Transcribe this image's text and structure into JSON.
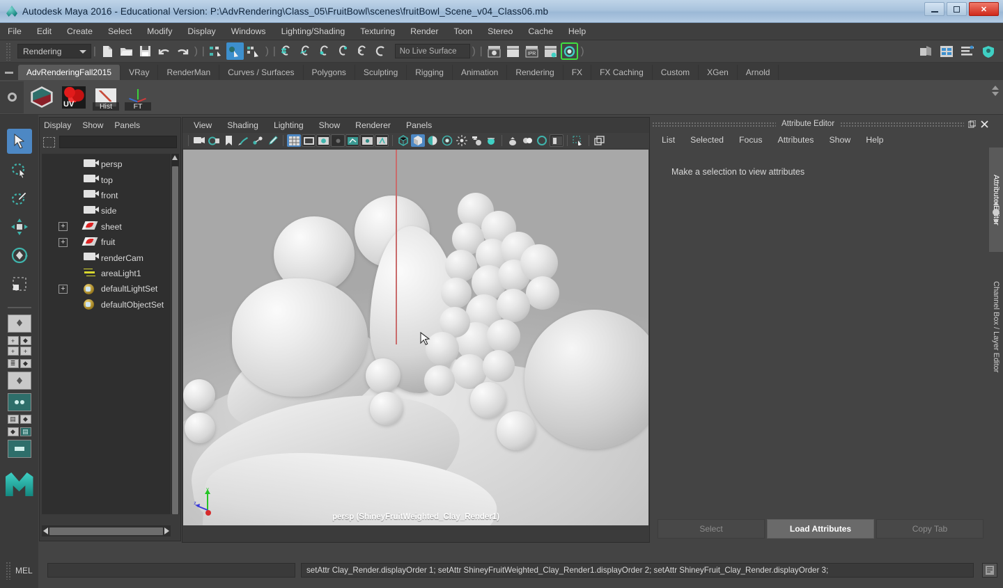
{
  "window": {
    "title": "Autodesk Maya 2016 - Educational Version: P:\\AdvRendering\\Class_05\\FruitBowl\\scenes\\fruitBowl_Scene_v04_Class06.mb",
    "app_icon": "maya-logo-icon",
    "minimize": "–",
    "maximize": "□",
    "close": "✕"
  },
  "menubar": {
    "items": [
      "File",
      "Edit",
      "Create",
      "Select",
      "Modify",
      "Display",
      "Windows",
      "Lighting/Shading",
      "Texturing",
      "Render",
      "Toon",
      "Stereo",
      "Cache",
      "Help"
    ]
  },
  "statusline": {
    "menuset": "Rendering",
    "live_surface": "No Live Surface",
    "file_icons": [
      "new-scene-icon",
      "open-scene-icon",
      "save-scene-icon",
      "undo-icon",
      "redo-icon"
    ],
    "select_mode_icons": [
      "select-hierarchy-icon",
      "select-object-icon",
      "select-component-icon"
    ],
    "snap_icons": [
      "snap-grid-icon",
      "snap-curve-icon",
      "snap-point-icon",
      "snap-projected-center-icon",
      "snap-view-plane-icon",
      "make-live-icon"
    ],
    "render_icons": [
      "render-current-frame-icon",
      "render-sequence-icon",
      "ipr-render-icon",
      "render-settings-icon",
      "render-view-icon"
    ],
    "right_icons": [
      "hypergraph-icon",
      "attribute-editor-toggle-icon",
      "channel-box-toggle-icon",
      "tool-settings-icon"
    ]
  },
  "shelf": {
    "tabs": [
      "AdvRenderingFall2015",
      "VRay",
      "RenderMan",
      "Curves / Surfaces",
      "Polygons",
      "Sculpting",
      "Rigging",
      "Animation",
      "Rendering",
      "FX",
      "FX Caching",
      "Custom",
      "XGen",
      "Arnold"
    ],
    "active_tab": "AdvRenderingFall2015",
    "buttons": [
      {
        "name": "cube-shader-icon",
        "label": ""
      },
      {
        "name": "uv-texture-icon",
        "label": "UV"
      },
      {
        "name": "history-icon",
        "label": "Hist"
      },
      {
        "name": "freeze-transform-icon",
        "label": "FT"
      }
    ]
  },
  "toolbox": {
    "tools": [
      {
        "name": "select-tool",
        "icon": "arrow-cursor-icon",
        "selected": true
      },
      {
        "name": "lasso-select-tool",
        "icon": "lasso-icon",
        "selected": false
      },
      {
        "name": "paint-select-tool",
        "icon": "paint-brush-icon",
        "selected": false
      },
      {
        "name": "move-tool",
        "icon": "move-arrows-icon",
        "selected": false
      },
      {
        "name": "rotate-tool",
        "icon": "rotate-circle-icon",
        "selected": false
      },
      {
        "name": "scale-tool",
        "icon": "scale-box-icon",
        "selected": false
      }
    ],
    "layout_label": "quick-layout-buttons"
  },
  "outliner": {
    "menus": [
      "Display",
      "Show",
      "Panels"
    ],
    "search_placeholder": "",
    "search_value": "",
    "items": [
      {
        "label": "persp",
        "icon": "camera-icon",
        "expandable": false
      },
      {
        "label": "top",
        "icon": "camera-icon",
        "expandable": false
      },
      {
        "label": "front",
        "icon": "camera-icon",
        "expandable": false
      },
      {
        "label": "side",
        "icon": "camera-icon",
        "expandable": false
      },
      {
        "label": "sheet",
        "icon": "mesh-icon",
        "expandable": true
      },
      {
        "label": "fruit",
        "icon": "mesh-icon",
        "expandable": true
      },
      {
        "label": "renderCam",
        "icon": "camera-icon",
        "expandable": false
      },
      {
        "label": "areaLight1",
        "icon": "light-icon",
        "expandable": false
      },
      {
        "label": "defaultLightSet",
        "icon": "set-icon",
        "expandable": true
      },
      {
        "label": "defaultObjectSet",
        "icon": "set-icon",
        "expandable": false
      }
    ]
  },
  "viewport": {
    "menus": [
      "View",
      "Shading",
      "Lighting",
      "Show",
      "Renderer",
      "Panels"
    ],
    "caption": "persp (ShineyFruitWeighted_Clay_Render1)",
    "toolbar_icons": [
      "camera-attributes-icon",
      "two-sided-lighting-icon",
      "bookmark-icon",
      "grease-pencil-icon",
      "ik-handle-icon",
      "paint-effects-icon",
      "grid-toggle-icon",
      "film-gate-icon",
      "resolution-gate-icon",
      "gate-mask-icon",
      "xray-joints-icon",
      "exposure-icon",
      "gamma-icon",
      "wireframe-icon",
      "smooth-shade-icon",
      "shaded-wireframe-icon",
      "hardware-texturing-icon",
      "use-all-lights-icon",
      "shadows-icon",
      "screen-space-ao-icon",
      "motion-blur-icon",
      "multisample-icon",
      "depth-of-field-icon",
      "isolate-select-icon",
      "xray-mode-icon",
      "panel-zoom-icon"
    ],
    "axis_labels": {
      "x": "x",
      "y": "y",
      "z": "z"
    }
  },
  "attribute_editor": {
    "title": "Attribute Editor",
    "menus": [
      "List",
      "Selected",
      "Focus",
      "Attributes",
      "Show",
      "Help"
    ],
    "empty_message": "Make a selection to view attributes",
    "footer_buttons": [
      "Select",
      "Load Attributes",
      "Copy Tab"
    ],
    "primary_button": "Load Attributes",
    "undock_icon": "undock-icon",
    "close_icon": "close-icon"
  },
  "side_tabs": {
    "items": [
      "Attribute Editor",
      "Channel Box / Layer Editor"
    ],
    "active": "Attribute Editor"
  },
  "command_line": {
    "label": "MEL",
    "input_value": "",
    "input_placeholder": "",
    "output": "setAttr Clay_Render.displayOrder 1; setAttr ShineyFruitWeighted_Clay_Render1.displayOrder 2; setAttr ShineyFruit_Clay_Render.displayOrder 3;",
    "script_editor_icon": "script-editor-icon"
  },
  "colors": {
    "titlebar_start": "#bfd4e8",
    "accent_blue": "#4d88c4",
    "accent_teal": "#3fd0c4",
    "panel_bg": "#444444",
    "dark_bg": "#2f2f2f",
    "close_red": "#cf2a1c",
    "green_highlight": "#3fe03f"
  }
}
